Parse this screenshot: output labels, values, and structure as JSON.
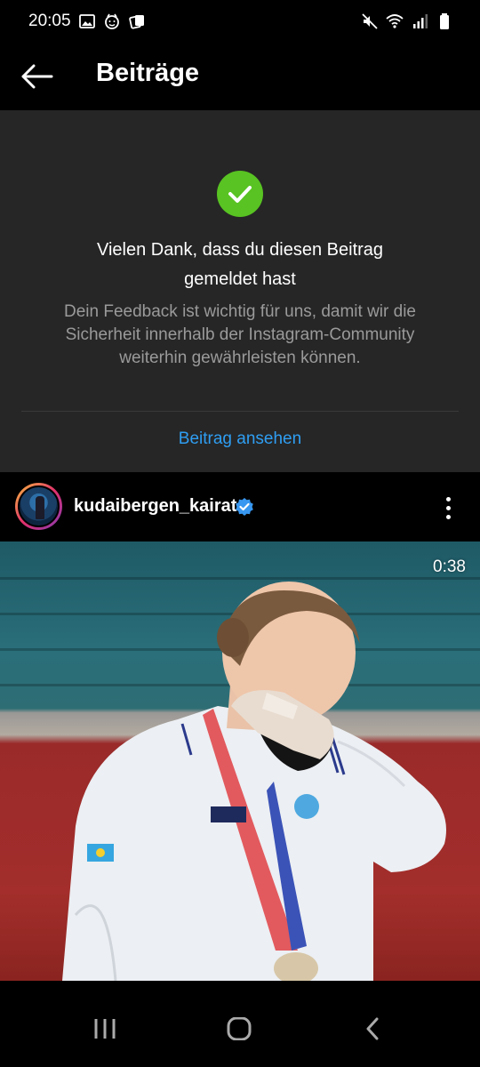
{
  "status_bar": {
    "time": "20:05",
    "left_icons": [
      "image-icon",
      "face-icon",
      "notification-icon"
    ],
    "right_icons": [
      "mute-icon",
      "wifi-icon",
      "signal-icon",
      "battery-icon"
    ]
  },
  "header": {
    "title": "Beiträge",
    "back_icon": "arrow-left-icon"
  },
  "report_confirmation": {
    "icon": "check-circle-icon",
    "icon_color": "#58c322",
    "title": "Vielen Dank, dass du diesen Beitrag gemeldet hast",
    "description": "Dein Feedback ist wichtig für uns, damit wir die Sicherheit innerhalb der Instagram-Community weiterhin gewährleisten können.",
    "link_label": "Beitrag ansehen",
    "link_color": "#2f9ef2"
  },
  "post": {
    "username": "kudaibergen_kairat",
    "verified": true,
    "verified_color": "#3897f0",
    "more_icon": "more-vertical-icon",
    "video_duration": "0:38"
  },
  "nav_bar": {
    "buttons": [
      "recent-apps-icon",
      "home-icon",
      "back-icon"
    ]
  }
}
